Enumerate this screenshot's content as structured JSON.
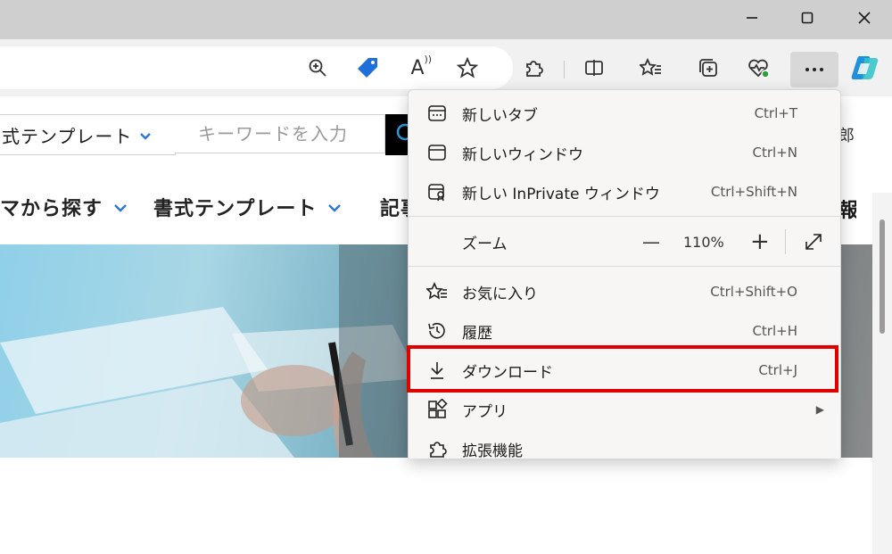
{
  "window": {
    "minimize_icon": "minimize-icon",
    "maximize_icon": "maximize-icon",
    "close_icon": "close-icon"
  },
  "toolbar": {
    "address_icons": [
      "zoom-in-icon",
      "price-tag-icon",
      "read-aloud-icon",
      "favorite-star-icon"
    ],
    "icons": [
      "extensions-icon",
      "split-screen-icon",
      "favorites-icon",
      "collections-icon",
      "browser-essentials-icon",
      "more-icon",
      "copilot-icon"
    ],
    "read_aloud_glyph": "A"
  },
  "page": {
    "template_select": "式テンプレート",
    "search_placeholder": "キーワードを入力",
    "nav": [
      {
        "label": "マから探す"
      },
      {
        "label": "書式テンプレート"
      },
      {
        "label": "記事"
      }
    ],
    "tail_text_1": "郎",
    "tail_text_2": "報",
    "accent_color": "#2a7ad5"
  },
  "menu": {
    "items": [
      {
        "label": "新しいタブ",
        "shortcut": "Ctrl+T",
        "icon": "new-tab-icon"
      },
      {
        "label": "新しいウィンドウ",
        "shortcut": "Ctrl+N",
        "icon": "new-window-icon"
      },
      {
        "label": "新しい InPrivate ウィンドウ",
        "shortcut": "Ctrl+Shift+N",
        "icon": "inprivate-window-icon"
      },
      {
        "label": "お気に入り",
        "shortcut": "Ctrl+Shift+O",
        "icon": "favorites-icon"
      },
      {
        "label": "履歴",
        "shortcut": "Ctrl+H",
        "icon": "history-icon"
      },
      {
        "label": "ダウンロード",
        "shortcut": "Ctrl+J",
        "icon": "download-icon"
      },
      {
        "label": "アプリ",
        "shortcut": "",
        "icon": "apps-icon"
      },
      {
        "label": "拡張機能",
        "shortcut": "",
        "icon": "extensions-icon"
      }
    ],
    "zoom": {
      "label": "ズーム",
      "minus": "—",
      "value": "110%",
      "plus": "+"
    },
    "highlight_color": "#e00000"
  }
}
